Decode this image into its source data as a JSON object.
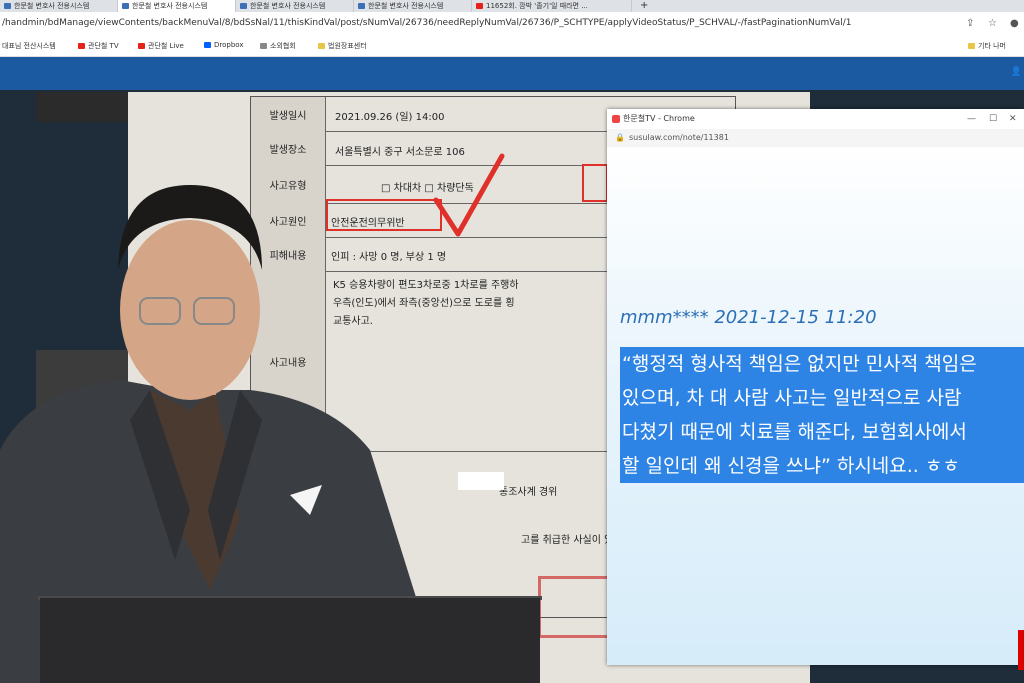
{
  "browser": {
    "tabs": [
      {
        "label": "한문철 변호사 전용시스템"
      },
      {
        "label": "한문철 변호사 전용시스템"
      },
      {
        "label": "한문철 변호사 전용시스템"
      },
      {
        "label": "한문철 변호사 전용시스템"
      },
      {
        "label": "11652회. 깜박 '졸기'일 때라면 ..."
      }
    ],
    "new_tab": "+",
    "url": "/handmin/bdManage/viewContents/backMenuVal/8/bdSsNal/11/thisKindVal/post/sNumVal/26736/needReplyNumVal/26736/P_SCHTYPE/applyVideoStatus/P_SCHVAL/-/fastPaginationNumVal/1",
    "bookmarks": [
      {
        "label": "대표님 전산시스템",
        "color": "#3b6fb6"
      },
      {
        "label": "관단철 TV",
        "color": "#e62117"
      },
      {
        "label": "관단철 Live",
        "color": "#e62117"
      },
      {
        "label": "Dropbox",
        "color": "#0061fe"
      },
      {
        "label": "소외협회",
        "color": "#888888"
      },
      {
        "label": "법원장표센터",
        "color": "#e8c547"
      }
    ],
    "other_bookmarks": "기타 나머"
  },
  "document": {
    "rows": [
      {
        "label": "발생일시",
        "value": "2021.09.26 (일) 14:00"
      },
      {
        "label": "발생장소",
        "value": "서울특별시 중구 서소문로 106"
      },
      {
        "label": "사고유형",
        "value": "□ 차대차          □ 차량단독"
      },
      {
        "label": "사고원인",
        "value": "안전운전의무위반"
      },
      {
        "label": "피해내용",
        "value": "인피 : 사망 0 명,          부상 1 명"
      },
      {
        "label": "사고내용",
        "value": "K5 승용차량이 편도3차로중 1차로를 주행하\n우측(인도)에서 좌측(중앙선)으로 도로를 횡\n교통사고."
      }
    ],
    "footer_line1": "통조사계 경위",
    "footer_line2": "고를 취급한 사실이 있음을 확인"
  },
  "popup": {
    "title": "한문철TV - Chrome",
    "url": "susulaw.com/note/11381",
    "author": "mmm**** 2021-12-15 11:20",
    "quote_lines": [
      "“행정적 형사적 책임은 없지만 민사적 책임은",
      "있으며, 차 대 사람 사고는 일반적으로 사람",
      "다쳤기 때문에 치료를 해준다, 보험회사에서",
      "할 일인데 왜 신경을 쓰냐” 하시네요.. ㅎㅎ"
    ]
  }
}
